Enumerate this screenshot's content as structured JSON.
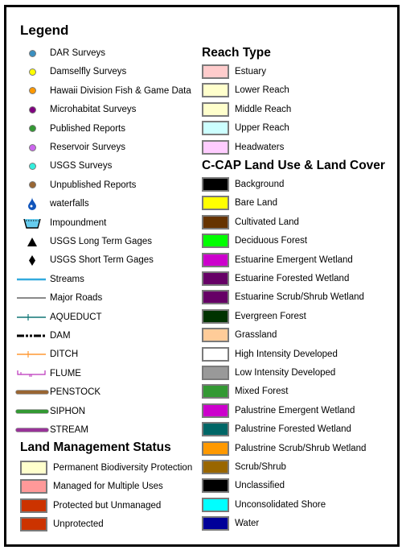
{
  "legend_title": "Legend",
  "point_symbols": [
    {
      "label": "DAR Surveys",
      "icon": "circle",
      "color": "#3a8fc0"
    },
    {
      "label": "Damselfly Surveys",
      "icon": "circle",
      "color": "#ffff00"
    },
    {
      "label": "Hawaii Division Fish & Game  Data",
      "icon": "circle",
      "color": "#ff9900"
    },
    {
      "label": "Microhabitat Surveys",
      "icon": "circle",
      "color": "#800080"
    },
    {
      "label": "Published Reports",
      "icon": "circle",
      "color": "#339933"
    },
    {
      "label": "Reservoir Surveys",
      "icon": "circle",
      "color": "#cc66ee"
    },
    {
      "label": "USGS Surveys",
      "icon": "circle",
      "color": "#33eedd"
    },
    {
      "label": "Unpublished Reports",
      "icon": "circle",
      "color": "#996633"
    },
    {
      "label": "waterfalls",
      "icon": "water-drop",
      "color": "#1155bb"
    },
    {
      "label": "Impoundment",
      "icon": "basin",
      "color": "#66ccee"
    },
    {
      "label": "USGS Long Term Gages",
      "icon": "triangle",
      "color": "#000000"
    },
    {
      "label": "USGS Short Term Gages",
      "icon": "diamond",
      "color": "#000000"
    }
  ],
  "line_symbols": [
    {
      "label": "Streams",
      "style": "solid",
      "color": "#33aadd"
    },
    {
      "label": "Major Roads",
      "style": "thin",
      "color": "#444444"
    },
    {
      "label": "AQUEDUCT",
      "style": "tick",
      "color": "#117777"
    },
    {
      "label": "DAM",
      "style": "dash-dot",
      "color": "#000000"
    },
    {
      "label": "DITCH",
      "style": "tick",
      "color": "#ff9933"
    },
    {
      "label": "FLUME",
      "style": "flume",
      "color": "#bb33bb"
    },
    {
      "label": "PENSTOCK",
      "style": "thick",
      "color": "#996633"
    },
    {
      "label": "SIPHON",
      "style": "thick",
      "color": "#339933"
    },
    {
      "label": "STREAM",
      "style": "thick",
      "color": "#993399"
    }
  ],
  "land_management": {
    "title": "Land Management Status",
    "items": [
      {
        "label": "Permanent Biodiversity Protection",
        "color": "#ffffcc"
      },
      {
        "label": "Managed for Multiple Uses",
        "color": "#ff9999"
      },
      {
        "label": "Protected but Unmanaged",
        "color": "#cc3300"
      },
      {
        "label": "Unprotected",
        "color": "#cc3300"
      }
    ]
  },
  "reach_type": {
    "title": "Reach Type",
    "items": [
      {
        "label": "Estuary",
        "color": "#ffcccc"
      },
      {
        "label": "Lower Reach",
        "color": "#ffffcc"
      },
      {
        "label": "Middle Reach",
        "color": "#ffffcc"
      },
      {
        "label": "Upper Reach",
        "color": "#ccffff"
      },
      {
        "label": "Headwaters",
        "color": "#ffccff"
      }
    ]
  },
  "ccap": {
    "title": "C-CAP Land Use & Land Cover",
    "items": [
      {
        "label": "Background",
        "color": "#000000"
      },
      {
        "label": "Bare Land",
        "color": "#ffff00"
      },
      {
        "label": "Cultivated Land",
        "color": "#663300"
      },
      {
        "label": "Deciduous Forest",
        "color": "#00ff00"
      },
      {
        "label": "Estuarine Emergent Wetland",
        "color": "#cc00cc"
      },
      {
        "label": "Estuarine Forested Wetland",
        "color": "#660066"
      },
      {
        "label": "Estuarine Scrub/Shrub Wetland",
        "color": "#660066"
      },
      {
        "label": "Evergreen Forest",
        "color": "#003300"
      },
      {
        "label": "Grassland",
        "color": "#ffcc99"
      },
      {
        "label": "High Intensity Developed",
        "color": "#ffffff"
      },
      {
        "label": "Low Intensity Developed",
        "color": "#999999"
      },
      {
        "label": "Mixed Forest",
        "color": "#339933"
      },
      {
        "label": "Palustrine Emergent Wetland",
        "color": "#cc00cc"
      },
      {
        "label": "Palustrine Forested Wetland",
        "color": "#006666"
      },
      {
        "label": "Palustrine Scrub/Shrub Wetland",
        "color": "#ff9900"
      },
      {
        "label": "Scrub/Shrub",
        "color": "#996600"
      },
      {
        "label": "Unclassified",
        "color": "#000000"
      },
      {
        "label": "Unconsolidated Shore",
        "color": "#00ffff"
      },
      {
        "label": "Water",
        "color": "#000099"
      }
    ]
  }
}
